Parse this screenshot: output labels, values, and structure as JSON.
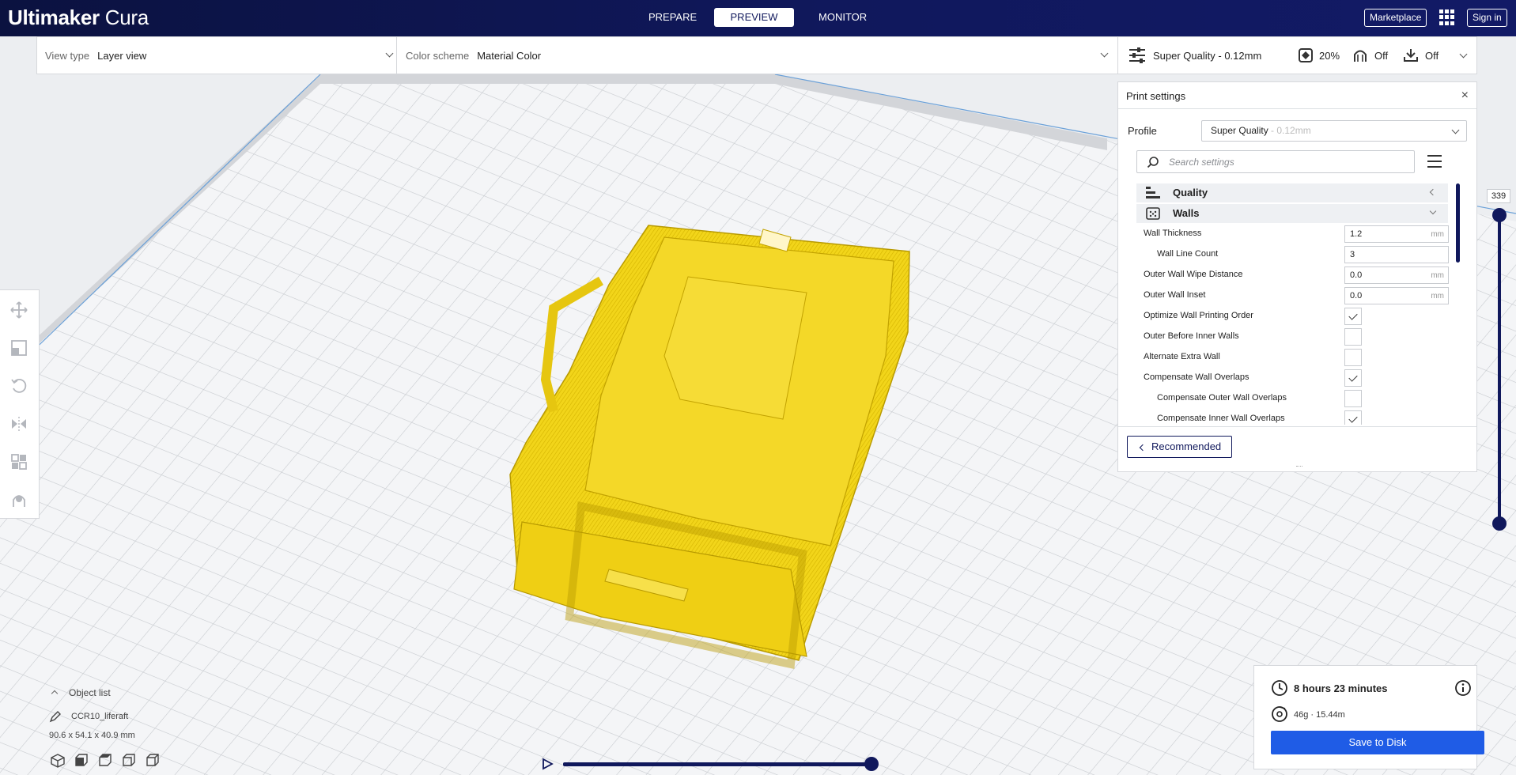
{
  "app": {
    "logo_bold": "Ultimaker",
    "logo_light": " Cura"
  },
  "stages": [
    {
      "label": "PREPARE",
      "active": false
    },
    {
      "label": "PREVIEW",
      "active": true
    },
    {
      "label": "MONITOR",
      "active": false
    }
  ],
  "header": {
    "marketplace": "Marketplace",
    "signin": "Sign in"
  },
  "view_bar": {
    "view_type_key": "View type",
    "view_type_value": "Layer view",
    "color_scheme_key": "Color scheme",
    "color_scheme_value": "Material Color"
  },
  "print_bar": {
    "profile": "Super Quality - 0.12mm",
    "infill": "20%",
    "support": "Off",
    "adhesion": "Off"
  },
  "settings": {
    "title": "Print settings",
    "close": "×",
    "profile_label": "Profile",
    "profile_name": "Super Quality",
    "profile_suffix": " - 0.12mm",
    "search_placeholder": "Search settings",
    "categories": [
      {
        "name": "Quality",
        "expanded": false
      },
      {
        "name": "Walls",
        "expanded": true
      }
    ],
    "rows": [
      {
        "label": "Wall Thickness",
        "type": "number",
        "value": "1.2",
        "unit": "mm",
        "indent": false
      },
      {
        "label": "Wall Line Count",
        "type": "number",
        "value": "3",
        "unit": "",
        "indent": true
      },
      {
        "label": "Outer Wall Wipe Distance",
        "type": "number",
        "value": "0.0",
        "unit": "mm",
        "indent": false
      },
      {
        "label": "Outer Wall Inset",
        "type": "number",
        "value": "0.0",
        "unit": "mm",
        "indent": false
      },
      {
        "label": "Optimize Wall Printing Order",
        "type": "check",
        "checked": true,
        "indent": false
      },
      {
        "label": "Outer Before Inner Walls",
        "type": "check",
        "checked": false,
        "indent": false
      },
      {
        "label": "Alternate Extra Wall",
        "type": "check",
        "checked": false,
        "indent": false
      },
      {
        "label": "Compensate Wall Overlaps",
        "type": "check",
        "checked": true,
        "indent": false
      },
      {
        "label": "Compensate Outer Wall Overlaps",
        "type": "check",
        "checked": false,
        "indent": true
      },
      {
        "label": "Compensate Inner Wall Overlaps",
        "type": "check",
        "checked": true,
        "indent": true
      }
    ],
    "recommended": "Recommended"
  },
  "layer_slider": {
    "current_layer": "339"
  },
  "object_list": {
    "header": "Object list",
    "object_name": "CCR10_liferaft",
    "dimensions": "90.6 x 54.1 x 40.9 mm"
  },
  "print_info": {
    "time": "8 hours 23 minutes",
    "material": "46g · 15.44m",
    "save": "Save to Disk"
  },
  "colors": {
    "header": "#10185c",
    "accent": "#1f5ce6",
    "model": "#f0d21e"
  }
}
